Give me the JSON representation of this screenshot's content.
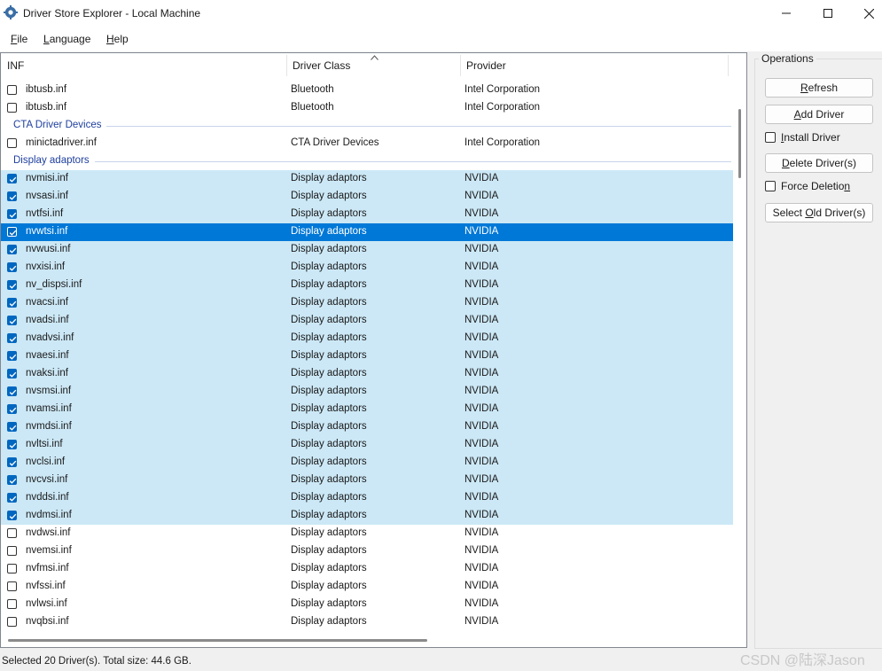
{
  "window": {
    "title": "Driver Store Explorer - Local Machine",
    "controls": [
      "minimize",
      "maximize",
      "close"
    ]
  },
  "menu": [
    {
      "mnemonic": "F",
      "rest": "ile"
    },
    {
      "mnemonic": "",
      "rest": "Language",
      "pre": "",
      "l": "L"
    },
    {
      "mnemonic": "H",
      "rest": "elp"
    }
  ],
  "columns": [
    "INF",
    "Driver Class",
    "Provider"
  ],
  "rows": [
    {
      "type": "row",
      "inf": "ibtusb.inf",
      "cls": "Bluetooth",
      "provider": "Intel Corporation",
      "checked": false
    },
    {
      "type": "row",
      "inf": "ibtusb.inf",
      "cls": "Bluetooth",
      "provider": "Intel Corporation",
      "checked": false
    },
    {
      "type": "group",
      "title": "CTA Driver Devices"
    },
    {
      "type": "row",
      "inf": "minictadriver.inf",
      "cls": "CTA Driver Devices",
      "provider": "Intel Corporation",
      "checked": false
    },
    {
      "type": "group",
      "title": "Display adaptors"
    },
    {
      "type": "row",
      "inf": "nvmisi.inf",
      "cls": "Display adaptors",
      "provider": "NVIDIA",
      "checked": true
    },
    {
      "type": "row",
      "inf": "nvsasi.inf",
      "cls": "Display adaptors",
      "provider": "NVIDIA",
      "checked": true
    },
    {
      "type": "row",
      "inf": "nvtfsi.inf",
      "cls": "Display adaptors",
      "provider": "NVIDIA",
      "checked": true
    },
    {
      "type": "row",
      "inf": "nvwtsi.inf",
      "cls": "Display adaptors",
      "provider": "NVIDIA",
      "checked": true,
      "selected": true
    },
    {
      "type": "row",
      "inf": "nvwusi.inf",
      "cls": "Display adaptors",
      "provider": "NVIDIA",
      "checked": true
    },
    {
      "type": "row",
      "inf": "nvxisi.inf",
      "cls": "Display adaptors",
      "provider": "NVIDIA",
      "checked": true
    },
    {
      "type": "row",
      "inf": "nv_dispsi.inf",
      "cls": "Display adaptors",
      "provider": "NVIDIA",
      "checked": true
    },
    {
      "type": "row",
      "inf": "nvacsi.inf",
      "cls": "Display adaptors",
      "provider": "NVIDIA",
      "checked": true
    },
    {
      "type": "row",
      "inf": "nvadsi.inf",
      "cls": "Display adaptors",
      "provider": "NVIDIA",
      "checked": true
    },
    {
      "type": "row",
      "inf": "nvadvsi.inf",
      "cls": "Display adaptors",
      "provider": "NVIDIA",
      "checked": true
    },
    {
      "type": "row",
      "inf": "nvaesi.inf",
      "cls": "Display adaptors",
      "provider": "NVIDIA",
      "checked": true
    },
    {
      "type": "row",
      "inf": "nvaksi.inf",
      "cls": "Display adaptors",
      "provider": "NVIDIA",
      "checked": true
    },
    {
      "type": "row",
      "inf": "nvsmsi.inf",
      "cls": "Display adaptors",
      "provider": "NVIDIA",
      "checked": true
    },
    {
      "type": "row",
      "inf": "nvamsi.inf",
      "cls": "Display adaptors",
      "provider": "NVIDIA",
      "checked": true
    },
    {
      "type": "row",
      "inf": "nvmdsi.inf",
      "cls": "Display adaptors",
      "provider": "NVIDIA",
      "checked": true
    },
    {
      "type": "row",
      "inf": "nvltsi.inf",
      "cls": "Display adaptors",
      "provider": "NVIDIA",
      "checked": true
    },
    {
      "type": "row",
      "inf": "nvclsi.inf",
      "cls": "Display adaptors",
      "provider": "NVIDIA",
      "checked": true
    },
    {
      "type": "row",
      "inf": "nvcvsi.inf",
      "cls": "Display adaptors",
      "provider": "NVIDIA",
      "checked": true
    },
    {
      "type": "row",
      "inf": "nvddsi.inf",
      "cls": "Display adaptors",
      "provider": "NVIDIA",
      "checked": true
    },
    {
      "type": "row",
      "inf": "nvdmsi.inf",
      "cls": "Display adaptors",
      "provider": "NVIDIA",
      "checked": true
    },
    {
      "type": "row",
      "inf": "nvdwsi.inf",
      "cls": "Display adaptors",
      "provider": "NVIDIA",
      "checked": false
    },
    {
      "type": "row",
      "inf": "nvemsi.inf",
      "cls": "Display adaptors",
      "provider": "NVIDIA",
      "checked": false
    },
    {
      "type": "row",
      "inf": "nvfmsi.inf",
      "cls": "Display adaptors",
      "provider": "NVIDIA",
      "checked": false
    },
    {
      "type": "row",
      "inf": "nvfssi.inf",
      "cls": "Display adaptors",
      "provider": "NVIDIA",
      "checked": false
    },
    {
      "type": "row",
      "inf": "nvlwsi.inf",
      "cls": "Display adaptors",
      "provider": "NVIDIA",
      "checked": false
    },
    {
      "type": "row",
      "inf": "nvqbsi.inf",
      "cls": "Display adaptors",
      "provider": "NVIDIA",
      "checked": false
    }
  ],
  "operations": {
    "title": "Operations",
    "refresh": {
      "u": "R",
      "rest": "efresh"
    },
    "add_driver": {
      "u": "A",
      "rest": "dd Driver"
    },
    "install_driver": {
      "u": "I",
      "rest": "nstall Driver"
    },
    "delete_drivers": {
      "u": "D",
      "rest": "elete Driver(s)"
    },
    "force_deletion": {
      "pre": "Force Deletio",
      "u": "n",
      "rest": ""
    },
    "select_old": {
      "pre": "Select ",
      "u": "O",
      "rest": "ld Driver(s)"
    }
  },
  "status": "Selected 20 Driver(s). Total size: 44.6 GB.",
  "watermark": "CSDN @陆深Jason",
  "colors": {
    "selected_row": "#0078d7",
    "checked_row": "#cce8f6",
    "group_header": "#1e3f9e",
    "checkbox_checked": "#0067c0"
  }
}
